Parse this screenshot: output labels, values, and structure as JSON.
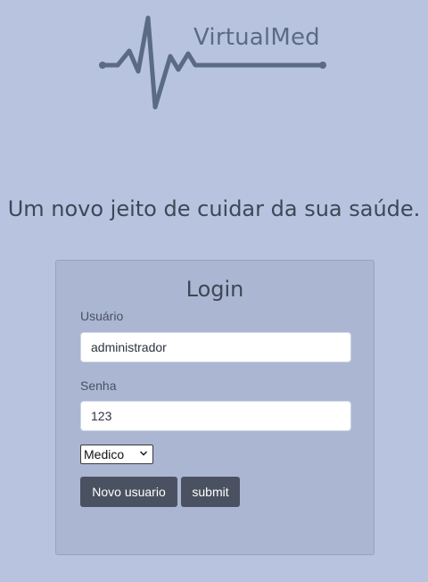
{
  "header": {
    "brand": "VirtualMed",
    "logo_icon": "heartbeat-pulse-icon",
    "logo_color": "#5b6b86"
  },
  "tagline": "Um novo jeito de cuidar da sua saúde.",
  "login": {
    "title": "Login",
    "user_label": "Usuário",
    "user_value": "administrador",
    "password_label": "Senha",
    "password_value": "123",
    "role_selected": "Medico",
    "new_user_button": "Novo usuario",
    "submit_button": "submit"
  },
  "colors": {
    "background": "#b8c4df",
    "card": "#abb6d2",
    "button": "#4a5261"
  }
}
